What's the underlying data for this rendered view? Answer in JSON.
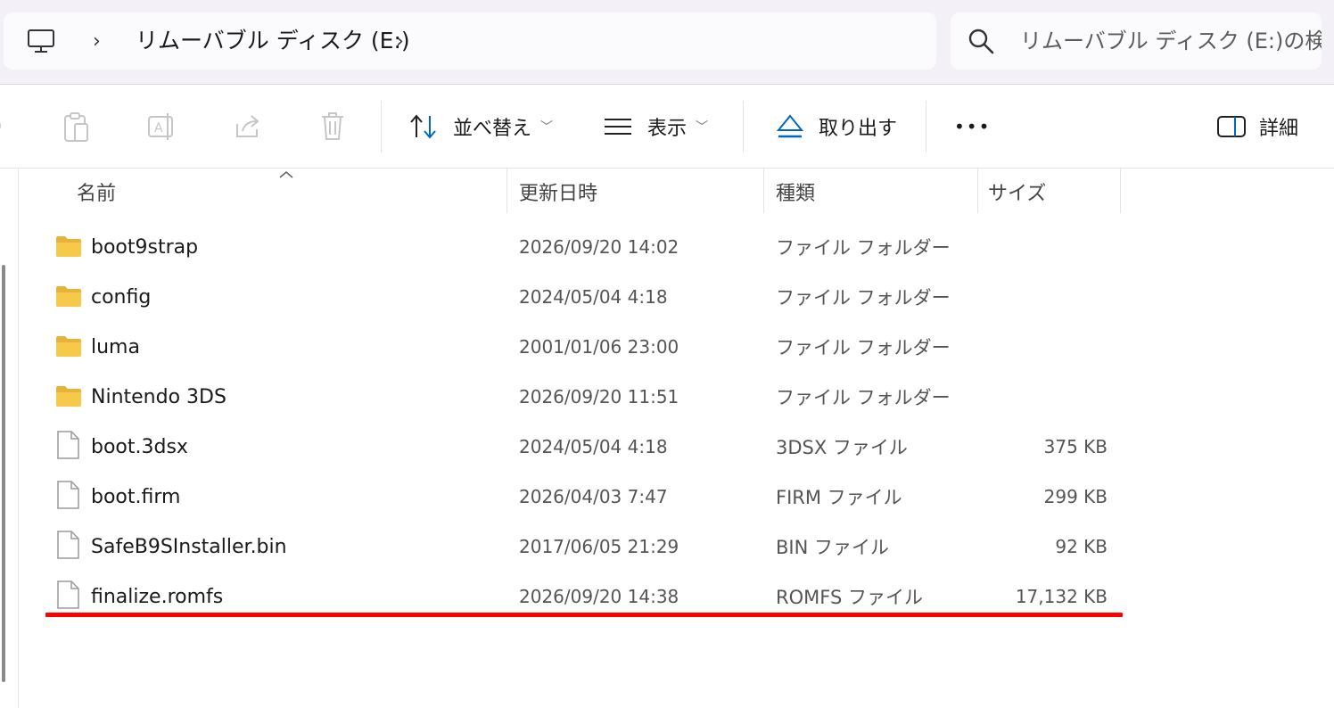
{
  "address": {
    "breadcrumb": "リムーバブル ディスク (E:)",
    "search_placeholder": "リムーバブル ディスク (E:)の検索"
  },
  "toolbar": {
    "sort_label": "並べ替え",
    "view_label": "表示",
    "eject_label": "取り出す",
    "more_label": "•••",
    "details_label": "詳細"
  },
  "columns": {
    "name": "名前",
    "modified": "更新日時",
    "type": "種類",
    "size": "サイズ"
  },
  "files": [
    {
      "name": "boot9strap",
      "modified": "2026/09/20 14:02",
      "type": "ファイル フォルダー",
      "size": "",
      "icon": "folder-icon"
    },
    {
      "name": "config",
      "modified": "2024/05/04 4:18",
      "type": "ファイル フォルダー",
      "size": "",
      "icon": "folder-icon"
    },
    {
      "name": "luma",
      "modified": "2001/01/06 23:00",
      "type": "ファイル フォルダー",
      "size": "",
      "icon": "folder-icon"
    },
    {
      "name": "Nintendo 3DS",
      "modified": "2026/09/20 11:51",
      "type": "ファイル フォルダー",
      "size": "",
      "icon": "folder-icon"
    },
    {
      "name": "boot.3dsx",
      "modified": "2024/05/04 4:18",
      "type": "3DSX ファイル",
      "size": "375 KB",
      "icon": "file-icon"
    },
    {
      "name": "boot.firm",
      "modified": "2026/04/03 7:47",
      "type": "FIRM ファイル",
      "size": "299 KB",
      "icon": "file-icon"
    },
    {
      "name": "SafeB9SInstaller.bin",
      "modified": "2017/06/05 21:29",
      "type": "BIN ファイル",
      "size": "92 KB",
      "icon": "file-icon"
    },
    {
      "name": "finalize.romfs",
      "modified": "2026/09/20 14:38",
      "type": "ROMFS ファイル",
      "size": "17,132 KB",
      "icon": "file-icon"
    }
  ],
  "colors": {
    "accent": "#0067c0",
    "highlight_mark": "#ff0000",
    "folder": "#f7c948"
  }
}
